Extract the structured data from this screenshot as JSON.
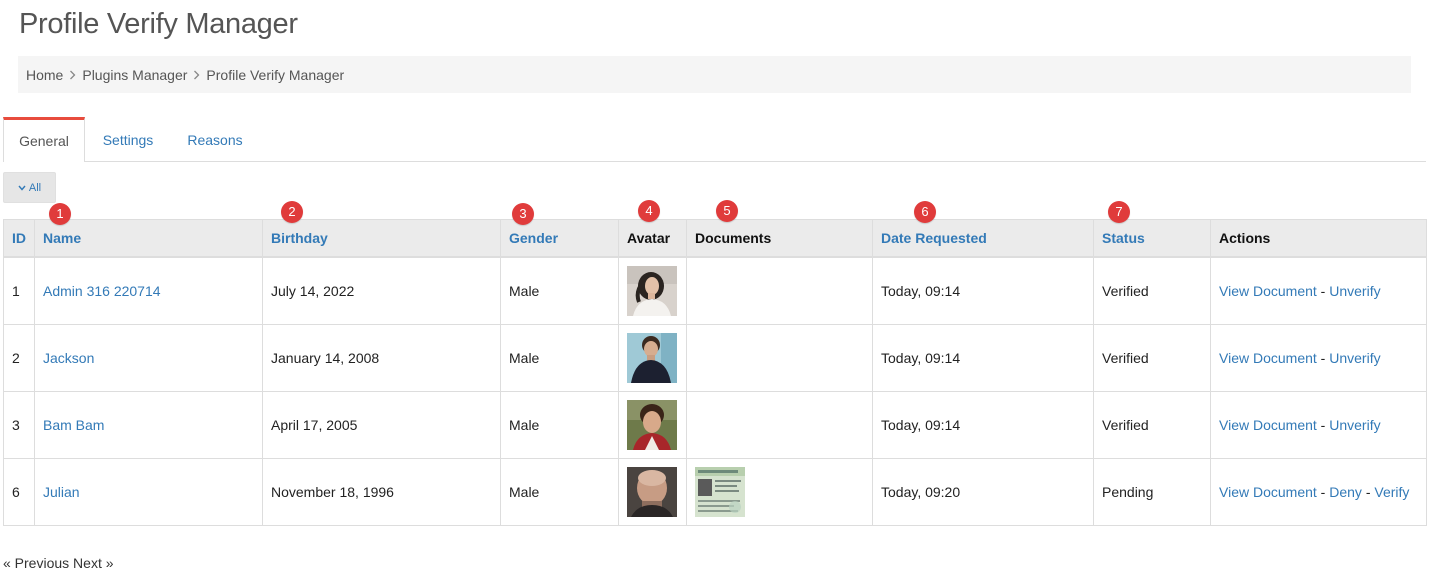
{
  "page": {
    "title": "Profile Verify Manager"
  },
  "breadcrumb": [
    "Home",
    "Plugins Manager",
    "Profile Verify Manager"
  ],
  "tabs": [
    {
      "label": "General",
      "active": true
    },
    {
      "label": "Settings",
      "active": false
    },
    {
      "label": "Reasons",
      "active": false
    }
  ],
  "filter": {
    "label": "All"
  },
  "markers": [
    "1",
    "2",
    "3",
    "4",
    "5",
    "6",
    "7"
  ],
  "table": {
    "headers": [
      "ID",
      "Name",
      "Birthday",
      "Gender",
      "Avatar",
      "Documents",
      "Date Requested",
      "Status",
      "Actions"
    ],
    "rows": [
      {
        "id": "1",
        "name": "Admin 316 220714",
        "birthday": "July 14, 2022",
        "gender": "Male",
        "date": "Today, 09:14",
        "status": "Verified",
        "has_document": false,
        "actions": [
          "View Document",
          "Unverify"
        ]
      },
      {
        "id": "2",
        "name": "Jackson",
        "birthday": "January 14, 2008",
        "gender": "Male",
        "date": "Today, 09:14",
        "status": "Verified",
        "has_document": false,
        "actions": [
          "View Document",
          "Unverify"
        ]
      },
      {
        "id": "3",
        "name": "Bam Bam",
        "birthday": "April 17, 2005",
        "gender": "Male",
        "date": "Today, 09:14",
        "status": "Verified",
        "has_document": false,
        "actions": [
          "View Document",
          "Unverify"
        ]
      },
      {
        "id": "6",
        "name": "Julian",
        "birthday": "November 18, 1996",
        "gender": "Male",
        "date": "Today, 09:20",
        "status": "Pending",
        "has_document": true,
        "actions": [
          "View Document",
          "Deny",
          "Verify"
        ]
      }
    ],
    "action_separator": " - "
  },
  "pager": {
    "previous": "« Previous",
    "next": "Next »"
  },
  "colors": {
    "link": "#337ab7",
    "marker": "#e03b3b",
    "active_tab_border": "#e84c3d"
  }
}
